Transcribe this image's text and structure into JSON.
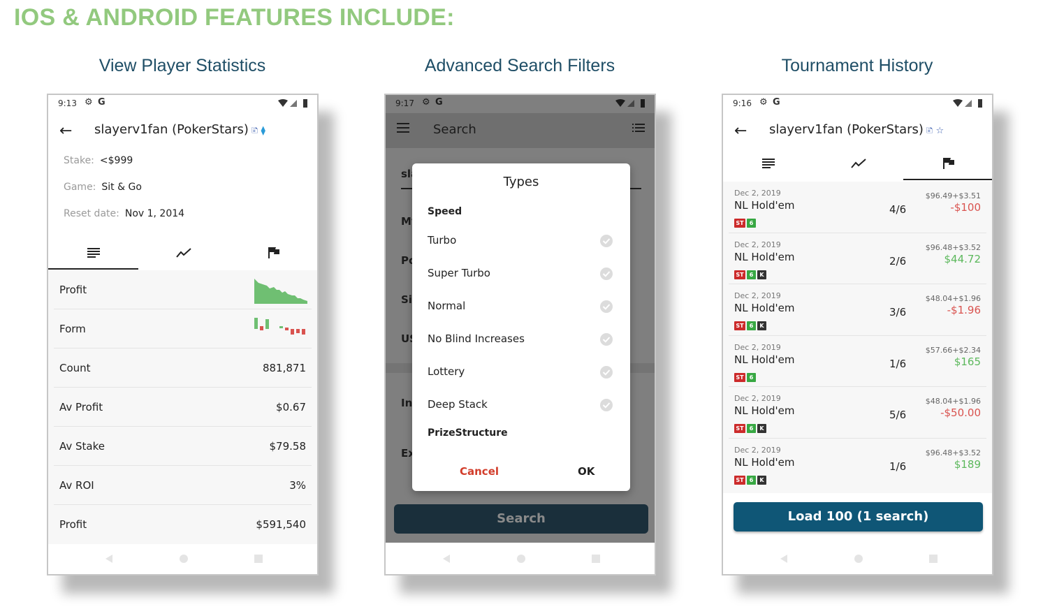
{
  "headline": "IOS & ANDROID FEATURES INCLUDE:",
  "colors": {
    "headline": "#92c97e",
    "title": "#1f4e66",
    "profit": "#5cb85c",
    "loss": "#d9534f",
    "cancel": "#d23d2b",
    "button": "#0f5676"
  },
  "panel1": {
    "title": "View Player Statistics",
    "status_time": "9:13",
    "player": "slayerv1fan (PokerStars)",
    "info": [
      {
        "label": "Stake:",
        "value": "<$999"
      },
      {
        "label": "Game:",
        "value": "Sit & Go"
      },
      {
        "label": "Reset date:",
        "value": "Nov 1, 2014"
      }
    ],
    "tab_icons": [
      "list-icon",
      "chart-line-icon",
      "flag-icon"
    ],
    "active_tab": 0,
    "stats": [
      {
        "label": "Profit",
        "value": ""
      },
      {
        "label": "Form",
        "value": ""
      },
      {
        "label": "Count",
        "value": "881,871"
      },
      {
        "label": "Av Profit",
        "value": "$0.67"
      },
      {
        "label": "Av Stake",
        "value": "$79.58"
      },
      {
        "label": "Av ROI",
        "value": "3%"
      },
      {
        "label": "Profit",
        "value": "$591,540"
      }
    ]
  },
  "panel2": {
    "title": "Advanced Search Filters",
    "status_time": "9:17",
    "toolbar_title": "Search",
    "behind_labels": [
      "sla",
      "My",
      "Po",
      "Sit",
      "US",
      "In",
      "Ex"
    ],
    "search_button": "Search",
    "dialog": {
      "title": "Types",
      "speed_header": "Speed",
      "items": [
        "Turbo",
        "Super Turbo",
        "Normal",
        "No Blind Increases",
        "Lottery",
        "Deep Stack"
      ],
      "prize_header": "PrizeStructure",
      "cancel": "Cancel",
      "ok": "OK"
    }
  },
  "panel3": {
    "title": "Tournament History",
    "status_time": "9:16",
    "player": "slayerv1fan (PokerStars)",
    "active_tab": 2,
    "tournaments": [
      {
        "date": "Dec 2, 2019",
        "game": "NL Hold'em",
        "position": "4/6",
        "buyin": "$96.49+$3.51",
        "result": "-$100",
        "badges": [
          "ST",
          "6"
        ]
      },
      {
        "date": "Dec 2, 2019",
        "game": "NL Hold'em",
        "position": "2/6",
        "buyin": "$96.48+$3.52",
        "result": "$44.72",
        "badges": [
          "ST",
          "6",
          "K"
        ]
      },
      {
        "date": "Dec 2, 2019",
        "game": "NL Hold'em",
        "position": "3/6",
        "buyin": "$48.04+$1.96",
        "result": "-$1.96",
        "badges": [
          "ST",
          "6",
          "K"
        ]
      },
      {
        "date": "Dec 2, 2019",
        "game": "NL Hold'em",
        "position": "1/6",
        "buyin": "$57.66+$2.34",
        "result": "$165",
        "badges": [
          "ST",
          "6"
        ]
      },
      {
        "date": "Dec 2, 2019",
        "game": "NL Hold'em",
        "position": "5/6",
        "buyin": "$48.04+$1.96",
        "result": "-$50.00",
        "badges": [
          "ST",
          "6",
          "K"
        ]
      },
      {
        "date": "Dec 2, 2019",
        "game": "NL Hold'em",
        "position": "1/6",
        "buyin": "$96.48+$3.52",
        "result": "$189",
        "badges": [
          "ST",
          "6",
          "K"
        ]
      }
    ],
    "load_button": "Load 100 (1 search)"
  }
}
